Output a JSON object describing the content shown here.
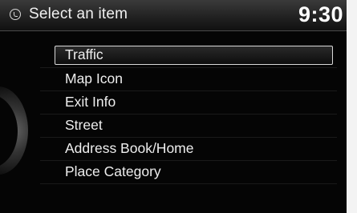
{
  "header": {
    "voice_icon": "voice-command-icon",
    "title": "Select an item",
    "clock": "9:30"
  },
  "menu": {
    "items": [
      {
        "label": "Traffic",
        "selected": true
      },
      {
        "label": "Map Icon",
        "selected": false
      },
      {
        "label": "Exit Info",
        "selected": false
      },
      {
        "label": "Street",
        "selected": false
      },
      {
        "label": "Address Book/Home",
        "selected": false
      },
      {
        "label": "Place Category",
        "selected": false
      }
    ]
  },
  "colors": {
    "background": "#050505",
    "text": "#eeeeee",
    "highlight_border": "#d9d9d9"
  }
}
